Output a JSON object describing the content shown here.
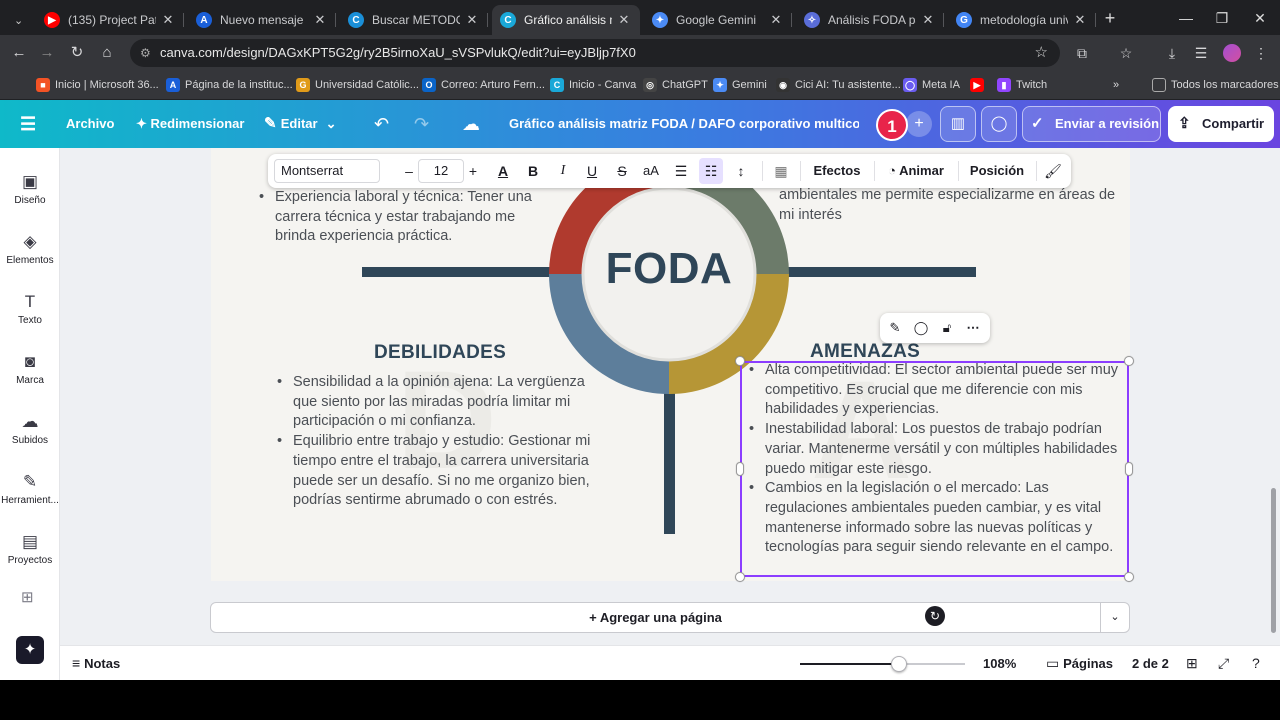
{
  "browser": {
    "tabs": [
      {
        "title": "(135) Project Pat",
        "fav_color": "#ff0000",
        "fav_glyph": "▶"
      },
      {
        "title": "Nuevo mensaje",
        "fav_color": "#1a5fd8",
        "fav_glyph": "A"
      },
      {
        "title": "Buscar METODOLOGÍA",
        "fav_color": "#1a8fd8",
        "fav_glyph": "C"
      },
      {
        "title": "Gráfico análisis matriz",
        "fav_color": "#1aa8d8",
        "fav_glyph": "C"
      },
      {
        "title": "Google Gemini",
        "fav_color": "#4b8bf5",
        "fav_glyph": "✦"
      },
      {
        "title": "Análisis FODA para la",
        "fav_color": "#5a6dd8",
        "fav_glyph": "✧"
      },
      {
        "title": "metodología univers",
        "fav_color": "#4285f4",
        "fav_glyph": "G"
      }
    ],
    "active_tab": 3,
    "url": "canva.com/design/DAGxKPT5G2g/ry2B5irnoXaU_sVSPvlukQ/edit?ui=eyJBljp7fX0",
    "bookmarks": [
      {
        "label": "Inicio | Microsoft 36...",
        "color": "#f35325",
        "glyph": "■"
      },
      {
        "label": "Página de la instituc...",
        "color": "#1a5fd8",
        "glyph": "A"
      },
      {
        "label": "Universidad Católic...",
        "color": "#e09b1a",
        "glyph": "G"
      },
      {
        "label": "Correo: Arturo Fern...",
        "color": "#0a64c8",
        "glyph": "O"
      },
      {
        "label": "Inicio - Canva",
        "color": "#1aa8d8",
        "glyph": "C"
      },
      {
        "label": "ChatGPT",
        "color": "#444444",
        "glyph": "◎"
      },
      {
        "label": "Gemini",
        "color": "#4b8bf5",
        "glyph": "✦"
      },
      {
        "label": "Cici AI: Tu asistente...",
        "color": "#333333",
        "glyph": "◉"
      },
      {
        "label": "Meta IA",
        "color": "#6a5cf0",
        "glyph": "◯"
      },
      {
        "label": "",
        "color": "#ff0000",
        "glyph": "▶"
      },
      {
        "label": "Twitch",
        "color": "#9146ff",
        "glyph": "▮"
      }
    ],
    "all_bookmarks": "Todos los marcadores"
  },
  "canva": {
    "menu_archivo": "Archivo",
    "menu_redimensionar": "Redimensionar",
    "menu_editar": "Editar",
    "doc_title": "Gráfico análisis matriz FODA / DAFO corporativo multicolor ...",
    "collab_count": "1",
    "review_label": "Enviar a revisión",
    "share_label": "Compartir"
  },
  "rail": [
    {
      "label": "Diseño",
      "icon": "▣"
    },
    {
      "label": "Elementos",
      "icon": "◈"
    },
    {
      "label": "Texto",
      "icon": "T"
    },
    {
      "label": "Marca",
      "icon": "◙"
    },
    {
      "label": "Subidos",
      "icon": "☁"
    },
    {
      "label": "Herramient...",
      "icon": "✎"
    },
    {
      "label": "Proyectos",
      "icon": "▤"
    }
  ],
  "text_toolbar": {
    "font": "Montserrat",
    "size": "12",
    "effects": "Efectos",
    "animate": "Animar",
    "position": "Posición"
  },
  "design": {
    "center_word": "FODA",
    "colors": {
      "red": "#b03a2e",
      "green": "#6c7b6a",
      "blue": "#5d7e9b",
      "gold": "#b69636",
      "navy": "#2f4658"
    },
    "top_left_bullets": [
      "Experiencia laboral y técnica: Tener una carrera técnica y estar trabajando me brinda experiencia práctica."
    ],
    "top_right_fragment": "ambientales me permite especializarme en áreas de mi interés",
    "weaknesses_title": "DEBILIDADES",
    "weaknesses": [
      "Sensibilidad a la opinión ajena: La vergüenza que siento por las miradas podría limitar mi participación o mi confianza.",
      "Equilibrio entre trabajo y estudio: Gestionar mi tiempo entre el trabajo, la carrera universitaria puede ser un desafío. Si no me organizo bien, podrías sentirme abrumado o con estrés."
    ],
    "threats_title": "AMENAZAS",
    "threats": [
      "Alta competitividad: El sector ambiental puede ser muy competitivo. Es crucial que me diferencie con mis habilidades y experiencias.",
      "Inestabilidad laboral: Los puestos de trabajo podrían variar. Mantenerme versátil y con múltiples habilidades puedo mitigar este riesgo.",
      "Cambios en la legislación o el mercado: Las regulaciones ambientales pueden cambiar, y es vital mantenerse informado sobre las nuevas políticas y tecnologías para seguir siendo relevante en el campo."
    ]
  },
  "add_page": "+ Agregar una página",
  "footer": {
    "notes": "Notas",
    "zoom": "108%",
    "zoom_fraction": 0.6,
    "pages": "Páginas",
    "page_indicator": "2 de 2"
  }
}
